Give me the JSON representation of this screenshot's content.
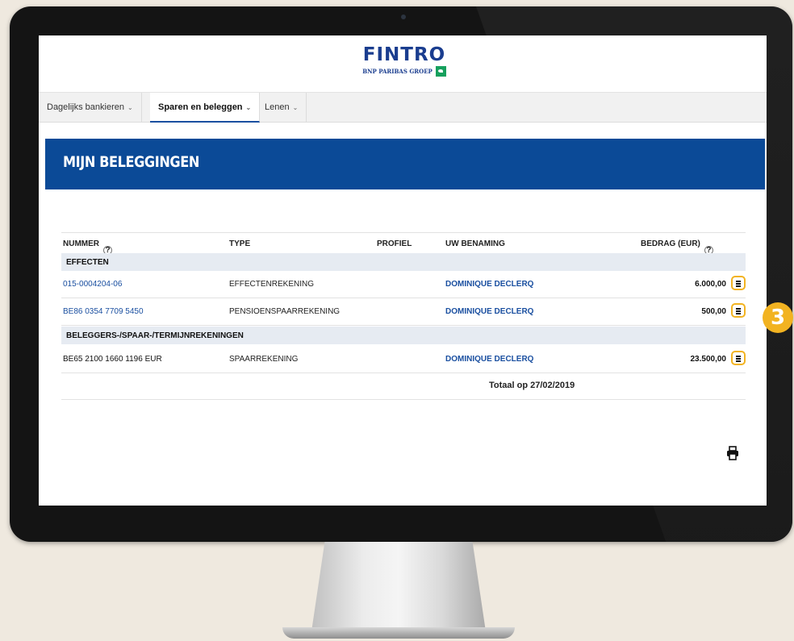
{
  "header": {
    "logo_text": "FINTRO",
    "logo_subtitle": "BNP PARIBAS GROEP"
  },
  "nav": {
    "items": [
      {
        "label": "Dagelijks bankieren",
        "active": false
      },
      {
        "label": "Sparen en beleggen",
        "active": true
      },
      {
        "label": "Lenen",
        "active": false
      }
    ]
  },
  "page": {
    "title": "MIJN BELEGGINGEN"
  },
  "table": {
    "columns": {
      "number": "NUMMER",
      "type": "TYPE",
      "profile": "PROFIEL",
      "name": "UW BENAMING",
      "amount": "BEDRAG (EUR)"
    },
    "groups": [
      {
        "label": "EFFECTEN",
        "rows": [
          {
            "number": "015-0004204-06",
            "type": "EFFECTENREKENING",
            "profile": "",
            "name": "DOMINIQUE DECLERQ",
            "amount": "6.000,00"
          },
          {
            "number": "BE86 0354 7709 5450",
            "type": "PENSIOENSPAARREKENING",
            "profile": "",
            "name": "DOMINIQUE DECLERQ",
            "amount": "500,00"
          }
        ]
      },
      {
        "label": "BELEGGERS-/SPAAR-/TERMIJNREKENINGEN",
        "rows": [
          {
            "number": "BE65 2100 1660 1196 EUR",
            "type": "SPAARREKENING",
            "profile": "",
            "name": "DOMINIQUE DECLERQ",
            "amount": "23.500,00"
          }
        ]
      }
    ],
    "total_label": "Totaal op 27/02/2019"
  },
  "annotation": {
    "step_number": "3",
    "highlight_color": "#f2b321"
  },
  "colors": {
    "brand_blue": "#0b4a97",
    "link_blue": "#1a4fa0",
    "group_bg": "#e6ebf2"
  }
}
